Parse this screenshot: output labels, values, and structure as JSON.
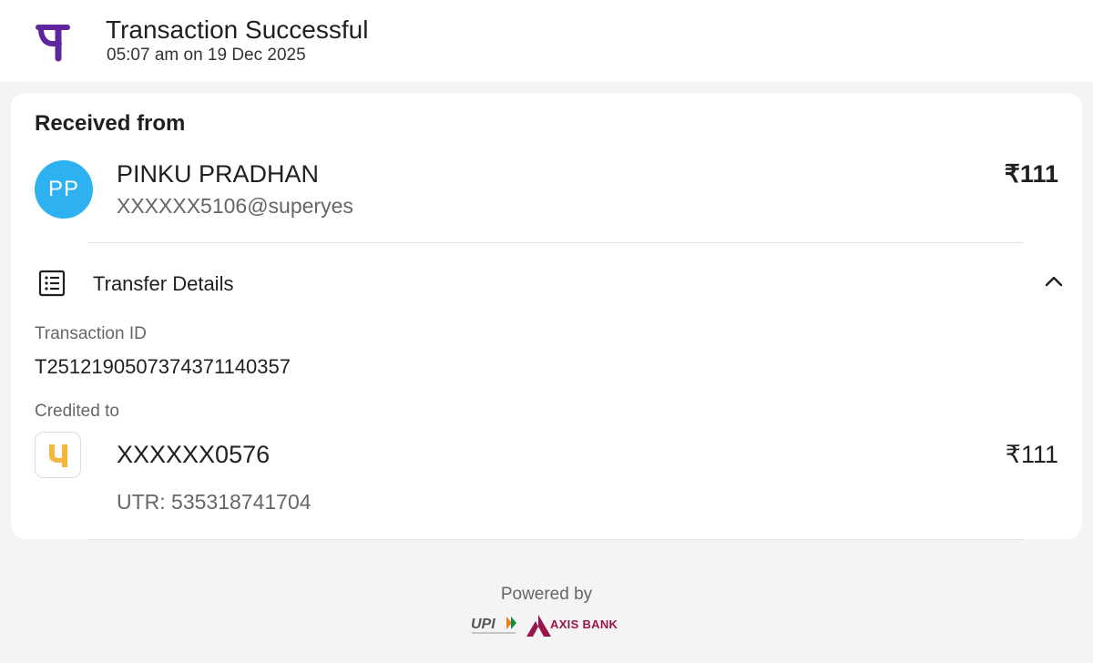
{
  "header": {
    "title": "Transaction Successful",
    "datetime": "05:07 am on 19 Dec 2025",
    "logo_icon": "phonepe-logo-icon",
    "brand_color": "#5f259f"
  },
  "received": {
    "section_label": "Received from",
    "avatar_initials": "PP",
    "avatar_color": "#2eb1f0",
    "name": "PINKU PRADHAN",
    "vpa": "XXXXXX5106@superyes",
    "amount": "₹111"
  },
  "transfer_details": {
    "label": "Transfer Details",
    "icon": "receipt-list-icon",
    "toggle_icon": "chevron-up-icon",
    "transaction_id_label": "Transaction ID",
    "transaction_id": "T2512190507374371140357",
    "credited_to_label": "Credited to",
    "bank_icon": "bank-logo-icon",
    "account": "XXXXXX0576",
    "amount": "₹111",
    "utr": "UTR: 535318741704"
  },
  "footer": {
    "powered_by": "Powered by",
    "upi_logo_text": "UPI",
    "partner_bank": "AXIS BANK",
    "partner_color": "#97144d"
  }
}
